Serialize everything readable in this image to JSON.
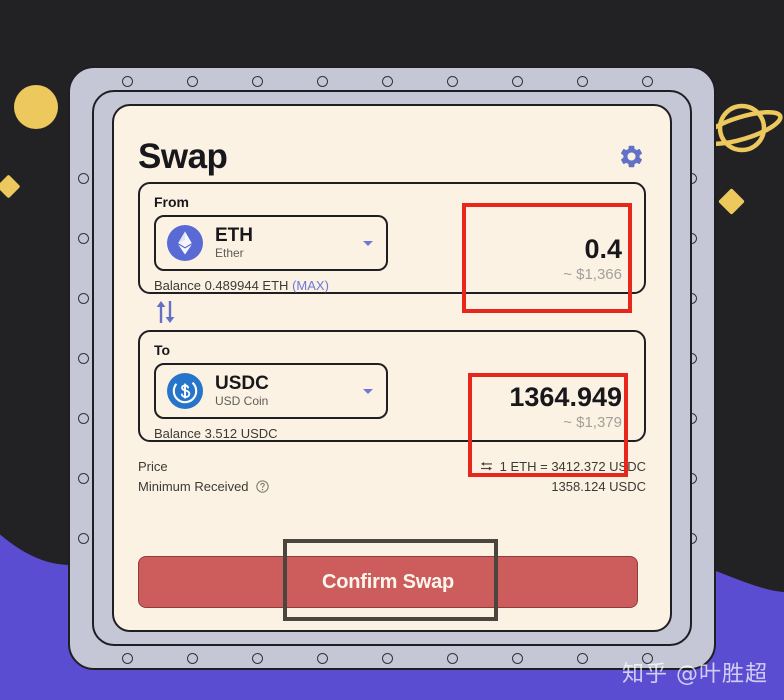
{
  "background": {
    "base_color": "#222225",
    "wave_color": "#5b4dd1",
    "accent_yellow": "#ecc85d",
    "decorations": [
      {
        "name": "yellow-circle"
      },
      {
        "name": "yellow-diamond-left"
      },
      {
        "name": "saturn-planet"
      },
      {
        "name": "yellow-diamond-right"
      }
    ]
  },
  "frame": {
    "body_color": "#c5c6d6",
    "outline_color": "#1f1f23"
  },
  "card": {
    "title": "Swap",
    "background": "#fbf2e3",
    "settings_icon": "gear-icon",
    "settings_color": "#6370c8"
  },
  "from": {
    "label": "From",
    "token": {
      "symbol": "ETH",
      "name": "Ether",
      "icon": "eth-token-icon",
      "icon_color": "#5a6ad4"
    },
    "balance_text": "Balance 0.489944 ETH",
    "max_label": "(MAX)",
    "max_color": "#6c79d8",
    "amount": "0.4",
    "amount_usd": "~ $1,366"
  },
  "switch": {
    "icon": "swap-vertical-arrows-icon",
    "color": "#6370c8"
  },
  "to": {
    "label": "To",
    "token": {
      "symbol": "USDC",
      "name": "USD Coin",
      "icon": "usdc-token-icon",
      "icon_color": "#2775ca"
    },
    "balance_text": "Balance 3.512 USDC",
    "amount": "1364.949",
    "amount_usd": "~ $1,379"
  },
  "price_info": {
    "price_label": "Price",
    "price_value": "1 ETH = 3412.372 USDC",
    "rate_icon": "swap-horizontal-arrows-icon",
    "minimum_received_label": "Minimum Received",
    "help_icon": "question-mark-circle-icon",
    "minimum_received_value": "1358.124 USDC"
  },
  "confirm": {
    "label": "Confirm Swap",
    "color": "#cd5c5c",
    "text_color": "#fdf6ec"
  },
  "annotations": {
    "from_amount_box_color": "#e8271c",
    "to_amount_box_color": "#e8271c",
    "confirm_box_color": "#4a463e"
  },
  "watermark": {
    "text": "知乎 @叶胜超"
  }
}
